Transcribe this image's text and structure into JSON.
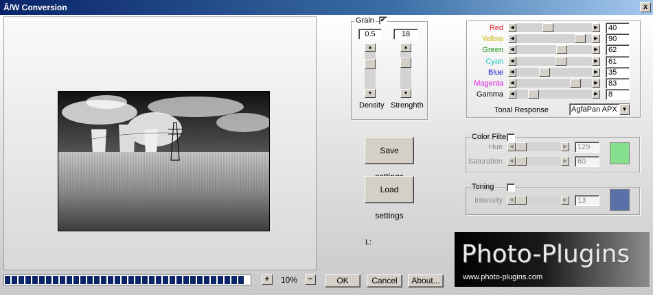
{
  "window": {
    "title": "Ã/W Conversion",
    "close_label": "x"
  },
  "preview": {
    "zoom": "10%",
    "zoom_in": "+",
    "zoom_out": "−"
  },
  "progress": {
    "segments": 35
  },
  "grain": {
    "title": "Grain",
    "enabled": true,
    "check_mark": "✔",
    "density": {
      "label": "Density",
      "value": "0.5",
      "level": 0.25
    },
    "strength": {
      "label": "Strenghth",
      "value": "18",
      "level": 0.2
    }
  },
  "channels": [
    {
      "name": "Red",
      "color": "#e0141e",
      "value": "40",
      "level": 0.4
    },
    {
      "name": "Yellow",
      "color": "#c8b400",
      "value": "90",
      "level": 0.9
    },
    {
      "name": "Green",
      "color": "#1e961e",
      "value": "62",
      "level": 0.62
    },
    {
      "name": "Cyan",
      "color": "#1ec8c8",
      "value": "61",
      "level": 0.61
    },
    {
      "name": "Blue",
      "color": "#1414dc",
      "value": "35",
      "level": 0.35
    },
    {
      "name": "Magenta",
      "color": "#dc14dc",
      "value": "83",
      "level": 0.83
    },
    {
      "name": "Gamma",
      "color": "#000000",
      "value": "8",
      "level": 0.18
    }
  ],
  "tonal": {
    "label": "Tonal Response",
    "selected": "AgfaPan APX"
  },
  "color_filter": {
    "title": "Color Filter",
    "enabled": false,
    "hue": {
      "label": "Hue",
      "value": "129",
      "level": 0.0
    },
    "saturation": {
      "label": "Saturation",
      "value": "60",
      "level": 0.0
    },
    "swatch": "#87e08f"
  },
  "toning": {
    "title": "Toning",
    "enabled": false,
    "intensity": {
      "label": "Intensity",
      "value": "13",
      "level": 0.0
    },
    "swatch": "#5a70a8"
  },
  "buttons": {
    "save": "Save settings",
    "load": "Load settings",
    "ok": "OK",
    "cancel": "Cancel",
    "about": "About..."
  },
  "luminance_label": "L:",
  "logo": {
    "main": "Photo-Plugins",
    "url": "www.photo-plugins.com"
  }
}
